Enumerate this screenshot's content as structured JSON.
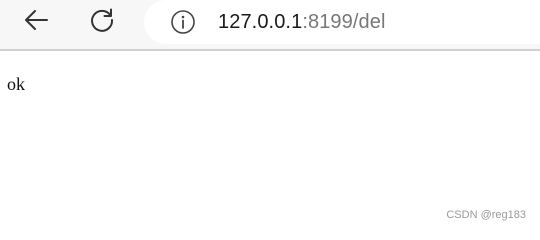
{
  "browser": {
    "back_icon": "arrow-left-icon",
    "reload_icon": "reload-icon",
    "info_icon": "info-icon",
    "url_host": "127.0.0.1",
    "url_path": ":8199/del"
  },
  "page": {
    "body_text": "ok"
  },
  "watermark": {
    "text": "CSDN @reg183"
  }
}
